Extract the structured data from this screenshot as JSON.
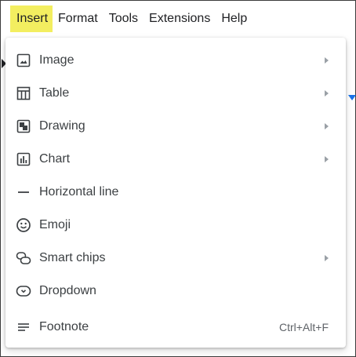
{
  "menubar": {
    "items": [
      {
        "label": "Insert"
      },
      {
        "label": "Format"
      },
      {
        "label": "Tools"
      },
      {
        "label": "Extensions"
      },
      {
        "label": "Help"
      }
    ]
  },
  "menu": {
    "items": [
      {
        "label": "Image",
        "icon": "image-icon",
        "submenu": true
      },
      {
        "label": "Table",
        "icon": "table-icon",
        "submenu": true
      },
      {
        "label": "Drawing",
        "icon": "drawing-icon",
        "submenu": true
      },
      {
        "label": "Chart",
        "icon": "chart-icon",
        "submenu": true
      },
      {
        "label": "Horizontal line",
        "icon": "horizontal-line-icon",
        "submenu": false
      },
      {
        "label": "Emoji",
        "icon": "emoji-icon",
        "submenu": false
      },
      {
        "label": "Smart chips",
        "icon": "smart-chips-icon",
        "submenu": true
      },
      {
        "label": "Dropdown",
        "icon": "dropdown-icon",
        "submenu": false
      },
      {
        "label": "Footnote",
        "icon": "footnote-icon",
        "submenu": false,
        "shortcut": "Ctrl+Alt+F"
      }
    ]
  },
  "colors": {
    "highlight": "#f3ee60",
    "hover": "#f1f3f4",
    "accent": "#1a73e8"
  }
}
